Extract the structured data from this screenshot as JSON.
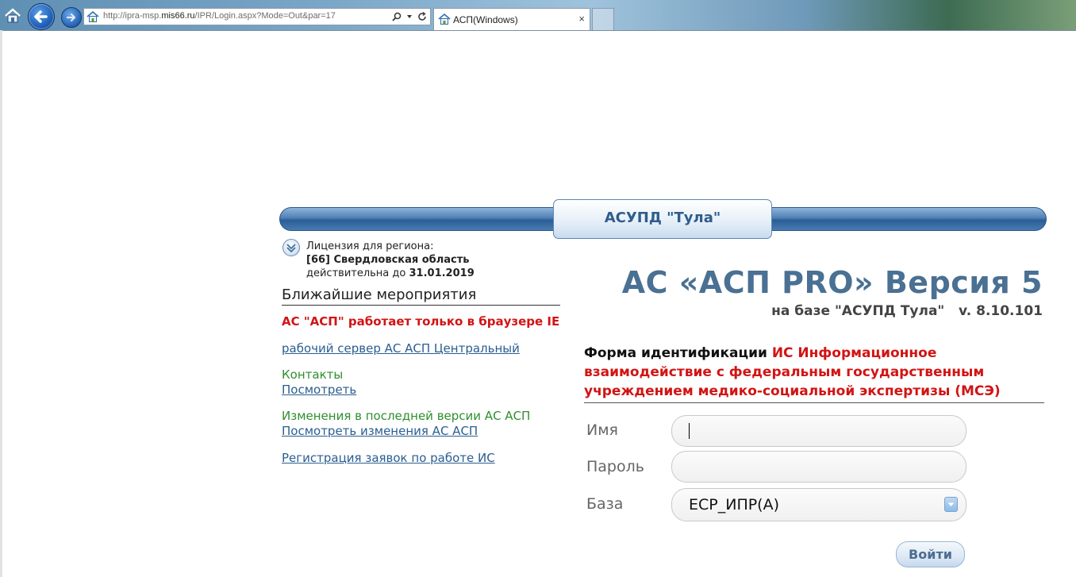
{
  "browser": {
    "url_prefix": "http://ipra-msp.",
    "url_domain": "mis66.ru",
    "url_path": "/IPR/Login.aspx?Mode=Out&par=17",
    "tab_title": "АСП(Windows)",
    "tab_close": "×"
  },
  "header": {
    "system_name": "АСУПД \"Тула\""
  },
  "license": {
    "label": "Лицензия для региона:",
    "region": "[66] Свердловская область",
    "valid_prefix": "действительна до",
    "valid_date": "31.01.2019"
  },
  "events": {
    "title": "Ближайшие мероприятия",
    "ie_note": "АС \"АСП\" работает только в браузере IE",
    "server_link": "рабочий сервер АС АСП Центральный",
    "contacts_label": "Контакты",
    "contacts_link": "Посмотреть",
    "changes_label": "Изменения в последней версии АС АСП",
    "changes_link": "Посмотреть изменения АС АСП",
    "registration_link": "Регистрация заявок по работе ИС"
  },
  "app": {
    "title": "АС «АСП PRO» Версия 5",
    "subtitle": "на базе \"АСУПД Тула\"   v. 8.10.101"
  },
  "form": {
    "heading_black": "Форма идентификации",
    "heading_red": "ИС Информационное взаимодействие с федеральным государственным учреждением медико-социальной экспертизы (МСЭ)",
    "name_label": "Имя",
    "name_value": "",
    "password_label": "Пароль",
    "password_value": "",
    "base_label": "База",
    "base_selected": "ЕСР_ИПР(А)",
    "login_button": "Войти"
  }
}
